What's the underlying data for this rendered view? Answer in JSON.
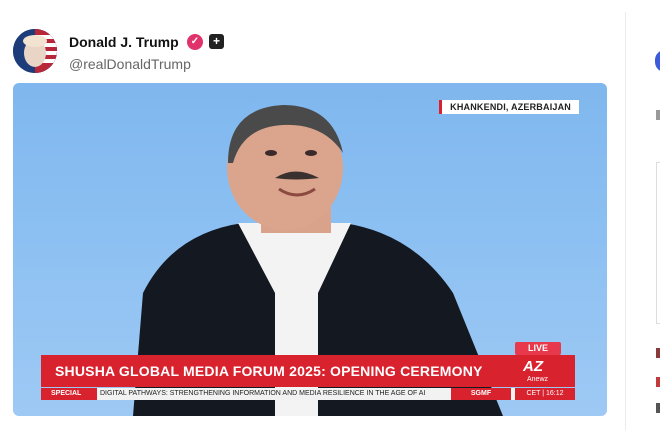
{
  "post": {
    "author_name": "Donald J. Trump",
    "handle": "@realDonaldTrump",
    "verified_icon": "verified-check-icon",
    "follow_icon": "plus-icon"
  },
  "media": {
    "location_tag": "KHANKENDI, AZERBAIJAN",
    "live_label": "LIVE",
    "headline": "SHUSHA GLOBAL MEDIA FORUM 2025: OPENING CEREMONY",
    "logo_text": "AZ",
    "logo_sub": "Anewz",
    "ticker_label": "SPECIAL",
    "ticker_text": "DIGITAL PATHWAYS: STRENGTHENING INFORMATION AND MEDIA RESILIENCE IN THE AGE OF AI",
    "ticker_tag": "SGMF",
    "clock": "CET | 16:12"
  },
  "colors": {
    "accent_red": "#d8232f",
    "verified_pink": "#e0336b"
  }
}
